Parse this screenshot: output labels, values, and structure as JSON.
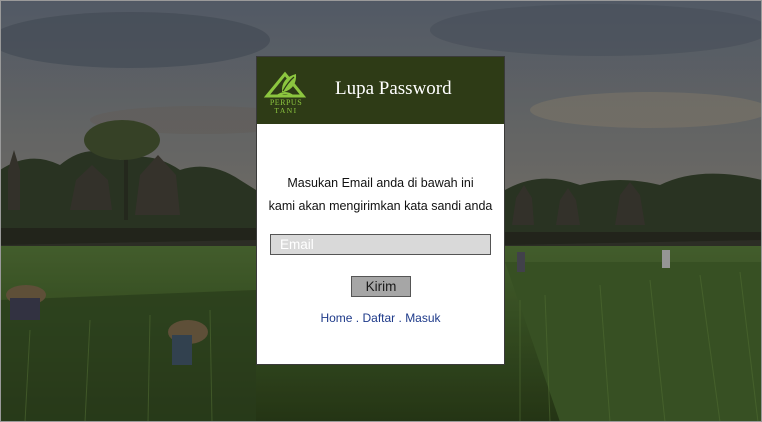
{
  "header": {
    "title": "Lupa Password",
    "logo_line1": "PERPUS",
    "logo_line2": "TANI"
  },
  "form": {
    "message_line1": "Masukan Email anda di bawah ini",
    "message_line2": "kami akan mengirimkan kata sandi anda",
    "email_placeholder": "Email",
    "email_value": "",
    "submit_label": "Kirim"
  },
  "links": {
    "home": "Home",
    "daftar": "Daftar",
    "masuk": "Masuk",
    "separator": " . "
  },
  "colors": {
    "header_bg": "#2e3b16",
    "logo_green": "#8cc63f",
    "link_blue": "#1e3a8a",
    "button_gray": "#a6a6a6",
    "input_gray": "#d9d9d9"
  },
  "icons": {
    "logo": "book-leaf-logo-icon"
  }
}
